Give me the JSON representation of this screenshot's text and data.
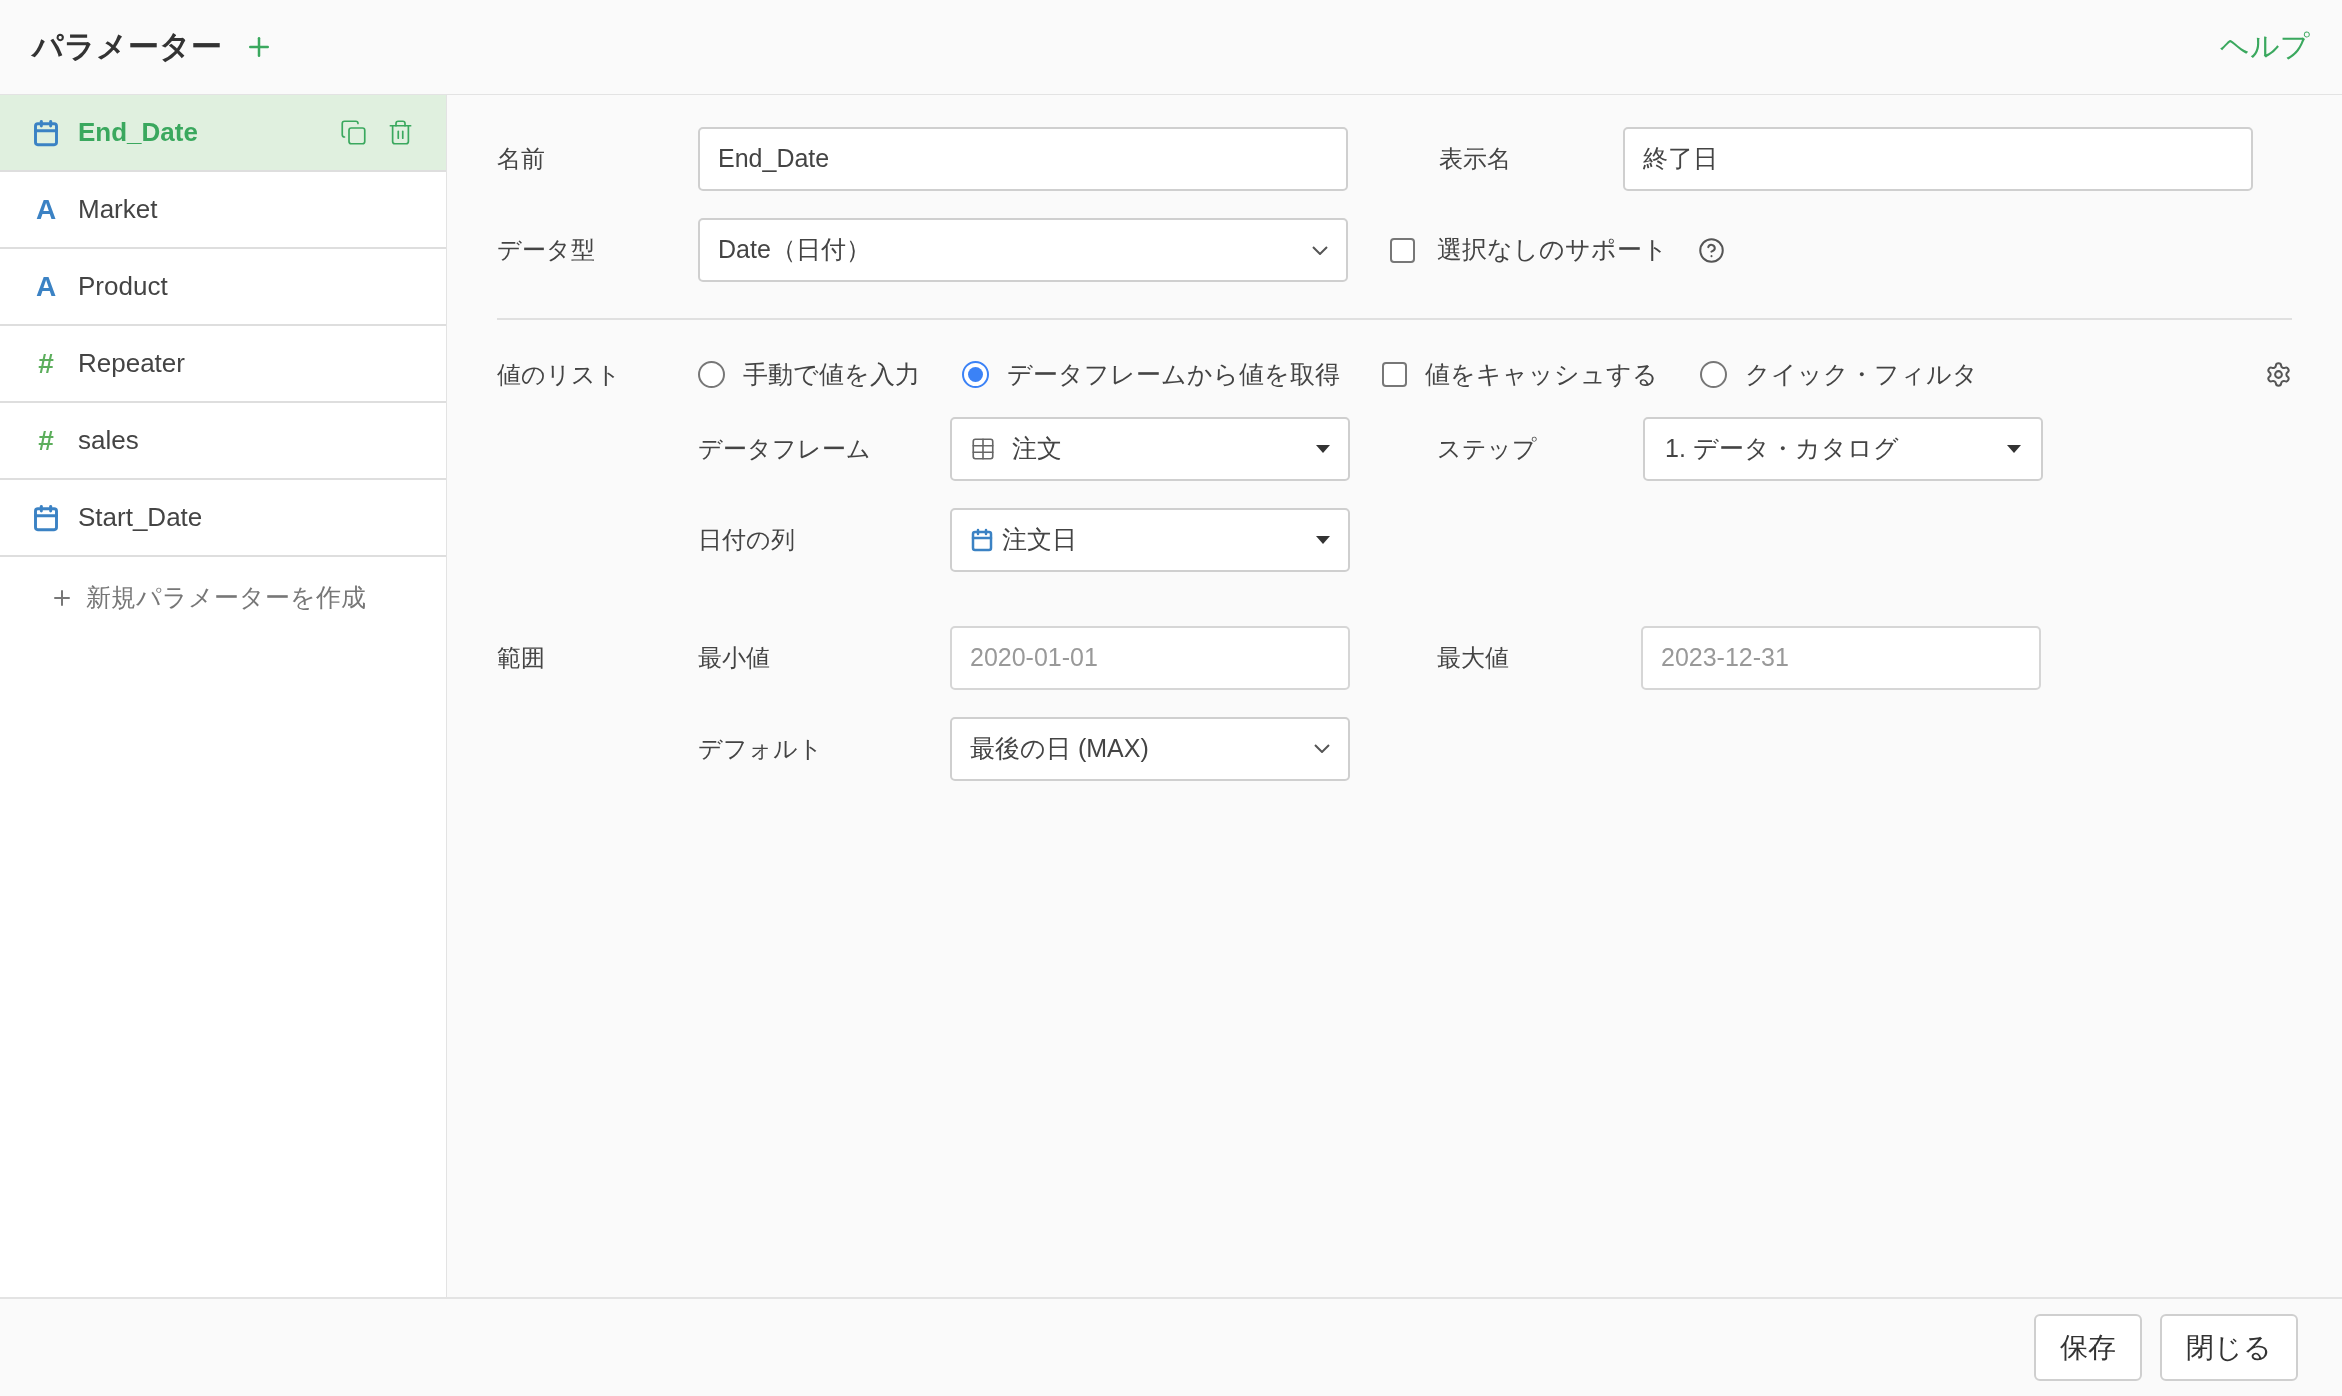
{
  "header": {
    "title": "パラメーター",
    "help": "ヘルプ"
  },
  "sidebar": {
    "items": [
      {
        "name": "End_Date",
        "kind": "date",
        "selected": true
      },
      {
        "name": "Market",
        "kind": "text",
        "icon": "A",
        "selected": false
      },
      {
        "name": "Product",
        "kind": "text",
        "icon": "A",
        "selected": false
      },
      {
        "name": "Repeater",
        "kind": "number",
        "icon": "#",
        "selected": false
      },
      {
        "name": "sales",
        "kind": "number",
        "icon": "#",
        "selected": false
      },
      {
        "name": "Start_Date",
        "kind": "date",
        "selected": false
      }
    ],
    "create_label": "新規パラメーターを作成"
  },
  "form": {
    "name": {
      "label": "名前",
      "value": "End_Date"
    },
    "display_name": {
      "label": "表示名",
      "value": "終了日"
    },
    "data_type": {
      "label": "データ型",
      "value": "Date（日付）"
    },
    "null_support": {
      "label": "選択なしのサポート",
      "checked": false
    },
    "value_list": {
      "label": "値のリスト",
      "options": [
        {
          "kind": "radio",
          "label": "手動で値を入力",
          "selected": false
        },
        {
          "kind": "radio",
          "label": "データフレームから値を取得",
          "selected": true
        },
        {
          "kind": "checkbox",
          "label": "値をキャッシュする",
          "checked": false
        },
        {
          "kind": "radio",
          "label": "クイック・フィルタ",
          "selected": false
        }
      ]
    },
    "dataframe": {
      "label": "データフレーム",
      "value": "注文"
    },
    "step": {
      "label": "ステップ",
      "value": "1. データ・カタログ"
    },
    "date_column": {
      "label": "日付の列",
      "value": "注文日"
    },
    "range": {
      "label": "範囲",
      "min": {
        "label": "最小値",
        "placeholder": "2020-01-01"
      },
      "max": {
        "label": "最大値",
        "placeholder": "2023-12-31"
      },
      "default": {
        "label": "デフォルト",
        "value": "最後の日 (MAX)"
      }
    }
  },
  "footer": {
    "buttons": [
      "保存",
      "閉じる"
    ]
  }
}
